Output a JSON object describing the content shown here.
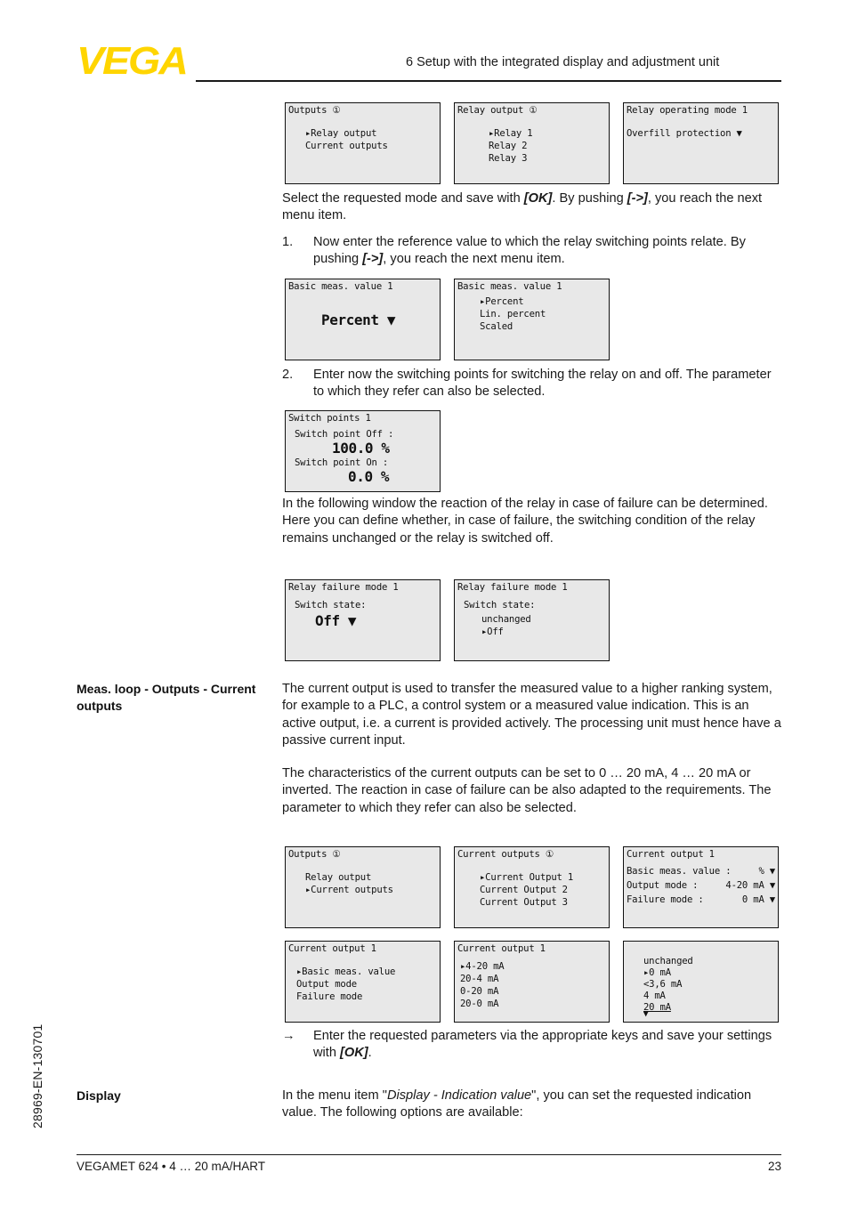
{
  "header": {
    "logo_text": "VEGA",
    "chapter_title": "6 Setup with the integrated display and adjustment unit"
  },
  "footer": {
    "product": "VEGAMET 624 • 4 … 20 mA/HART",
    "page_number": "23",
    "doc_number": "28969-EN-130701"
  },
  "paragraphs": {
    "p1_a": "Select the requested mode and save with ",
    "p1_ok": "[OK]",
    "p1_b": ". By pushing ",
    "p1_arrow": "[->]",
    "p1_c": ", you reach the next menu item.",
    "item1_marker": "1.",
    "item1_a": "Now enter the reference value to which the relay switching points relate. By pushing ",
    "item1_arrow": "[->]",
    "item1_b": ", you reach the next menu item.",
    "item2_marker": "2.",
    "item2_text": "Enter now the switching points for switching the relay on and off. The parameter to which they refer can also be selected.",
    "p2_text": "In the following window the reaction of the relay in case of failure can be determined. Here you can define whether, in case of failure, the switching condition of the relay remains unchanged or the relay is switched off.",
    "margin_head_1": "Meas. loop - Outputs - Current outputs",
    "p3_text": "The current output is used to transfer the measured value to a higher ranking system, for example to a PLC, a control system or a measured value indication. This is an active output, i.e. a current is provided actively. The processing unit must hence have a passive current input.",
    "p4_text": "The characteristics of the current outputs can be set to 0 … 20 mA, 4 … 20 mA or inverted. The reaction in case of failure can be also adapted to the requirements. The parameter to which they refer can also be selected.",
    "arrow_marker": "→",
    "p5_a": "Enter the requested parameters via the appropriate keys and save your settings with ",
    "p5_ok": "[OK]",
    "p5_b": ".",
    "margin_head_2": "Display",
    "p6_a": "In the menu item \"",
    "p6_ital": "Display - Indication value",
    "p6_b": "\", you can set the requested indication value. The following options are available:"
  },
  "panels": {
    "r1c1": {
      "title": "Outputs ①",
      "lines": [
        "▸Relay output",
        " Current outputs"
      ]
    },
    "r1c2": {
      "title": "Relay output ①",
      "lines": [
        "▸Relay 1",
        " Relay 2",
        " Relay 3"
      ]
    },
    "r1c3": {
      "title": "Relay operating mode  1",
      "value_line": "Overfill protection ▼"
    },
    "r2c1": {
      "title": "Basic meas. value  1",
      "big_value": "Percent ▼"
    },
    "r2c2": {
      "title": "Basic meas. value  1",
      "lines": [
        "▸Percent",
        " Lin. percent",
        " Scaled"
      ]
    },
    "r3c1": {
      "title": "Switch points  1",
      "label_off": "Switch point Off :",
      "value_off": "100.0 %",
      "label_on": "Switch point On :",
      "value_on": "0.0 %"
    },
    "r4c1": {
      "title": "Relay failure mode  1",
      "label": "Switch state:",
      "big_value": "Off ▼"
    },
    "r4c2": {
      "title": "Relay failure mode  1",
      "label": "Switch state:",
      "lines": [
        " unchanged",
        "▸Off"
      ]
    },
    "r5c1": {
      "title": "Outputs ①",
      "lines": [
        " Relay output",
        "▸Current outputs"
      ]
    },
    "r5c2": {
      "title": "Current outputs ①",
      "lines": [
        "▸Current Output 1",
        " Current Output 2",
        " Current Output 3"
      ]
    },
    "r5c3": {
      "title": "Current output  1",
      "rows": [
        {
          "label": "Basic meas. value :",
          "value": "% ▼"
        },
        {
          "label": "Output mode :",
          "value": "4-20 mA ▼"
        },
        {
          "label": "Failure mode :",
          "value": "0 mA ▼"
        }
      ]
    },
    "r6c1": {
      "title": "Current output  1",
      "lines": [
        "▸Basic meas. value",
        " Output mode",
        " Failure mode"
      ]
    },
    "r6c2": {
      "title": "Current output  1",
      "lines": [
        "▸4-20 mA",
        " 20-4 mA",
        " 0-20 mA",
        " 20-0 mA"
      ]
    },
    "r6c3": {
      "lines": [
        " unchanged",
        "▸0 mA",
        " <3,6 mA",
        " 4 mA"
      ],
      "underlined_line": "20 mA",
      "scroll_indicator": "▼"
    }
  }
}
